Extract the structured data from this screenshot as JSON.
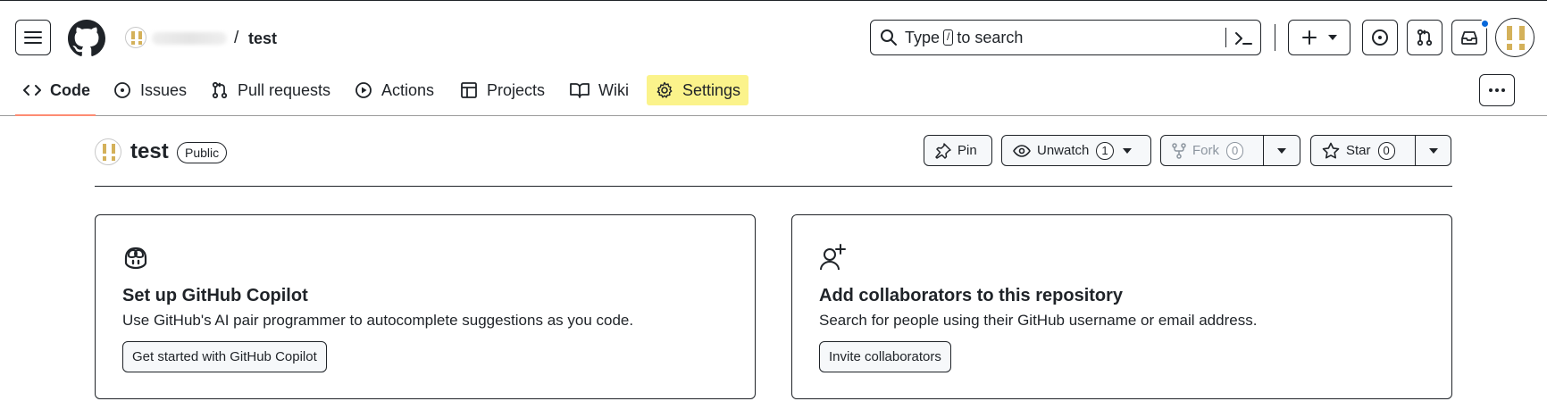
{
  "header": {
    "repo_name": "test",
    "breadcrumb_sep": "/",
    "search": {
      "prefix": "Type",
      "key": "/",
      "suffix": "to search"
    }
  },
  "tabs": [
    {
      "label": "Code",
      "icon": "code-icon",
      "active": true
    },
    {
      "label": "Issues",
      "icon": "issue-icon"
    },
    {
      "label": "Pull requests",
      "icon": "pull-request-icon"
    },
    {
      "label": "Actions",
      "icon": "play-icon"
    },
    {
      "label": "Projects",
      "icon": "table-icon"
    },
    {
      "label": "Wiki",
      "icon": "book-icon"
    },
    {
      "label": "Settings",
      "icon": "gear-icon",
      "highlighted": true
    }
  ],
  "repo": {
    "name": "test",
    "visibility": "Public",
    "actions": {
      "pin": "Pin",
      "unwatch": "Unwatch",
      "watch_count": "1",
      "fork": "Fork",
      "fork_count": "0",
      "star": "Star",
      "star_count": "0"
    }
  },
  "cards": [
    {
      "icon": "copilot-icon",
      "title": "Set up GitHub Copilot",
      "description": "Use GitHub's AI pair programmer to autocomplete suggestions as you code.",
      "button": "Get started with GitHub Copilot"
    },
    {
      "icon": "person-add-icon",
      "title": "Add collaborators to this repository",
      "description": "Search for people using their GitHub username or email address.",
      "button": "Invite collaborators"
    }
  ],
  "colors": {
    "accent_underline": "#fd8c73",
    "settings_highlight": "#fbf38b",
    "notification_dot": "#0969da",
    "avatar_gold": "#d4b15a"
  }
}
